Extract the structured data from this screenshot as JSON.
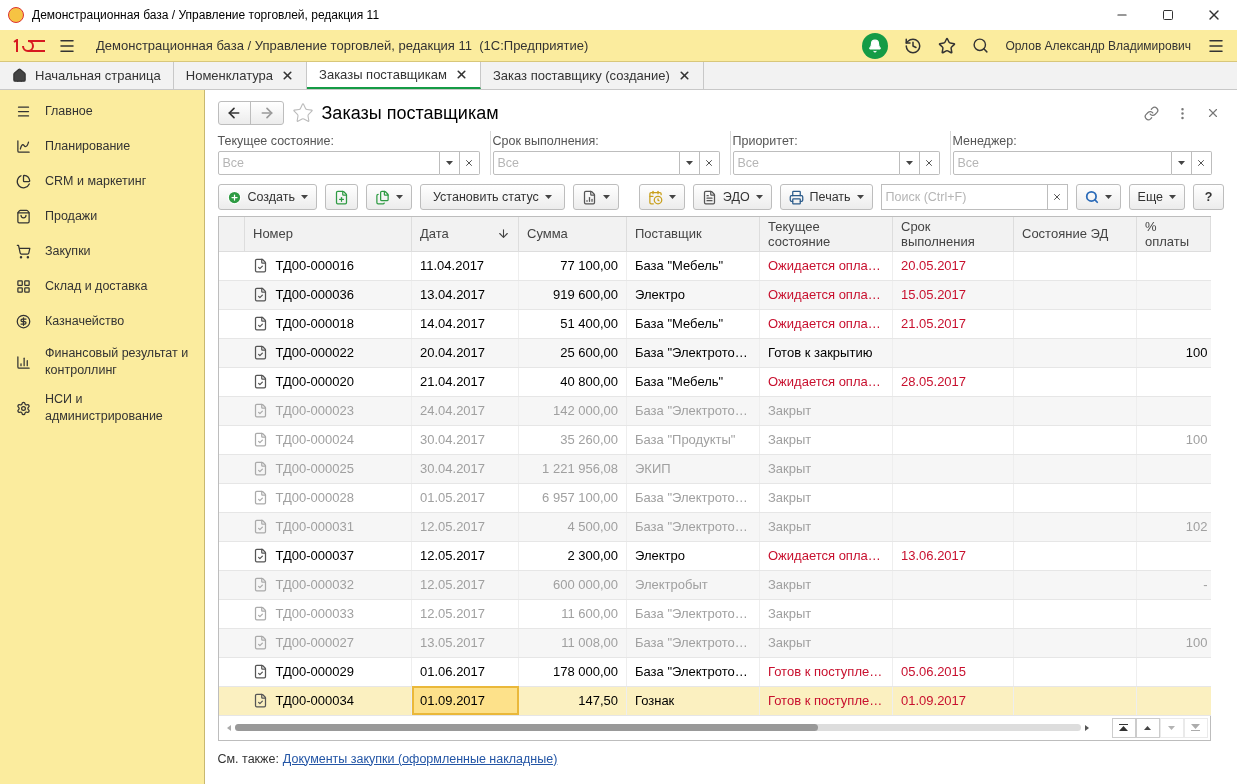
{
  "window": {
    "title": "Демонстрационная база / Управление торговлей, редакция 11"
  },
  "header": {
    "title": "Демонстрационная база / Управление торговлей, редакция 11  (1С:Предприятие)",
    "user": "Орлов Александр Владимирович"
  },
  "tabs": [
    {
      "label": "Начальная страница",
      "selected": false,
      "closable": false
    },
    {
      "label": "Номенклатура",
      "selected": false,
      "closable": true
    },
    {
      "label": "Заказы поставщикам",
      "selected": true,
      "closable": true
    },
    {
      "label": "Заказ поставщику (создание)",
      "selected": false,
      "closable": true
    }
  ],
  "sidebar": {
    "items": [
      {
        "label": "Главное"
      },
      {
        "label": "Планирование"
      },
      {
        "label": "CRM и маркетинг"
      },
      {
        "label": "Продажи"
      },
      {
        "label": "Закупки"
      },
      {
        "label": "Склад и доставка"
      },
      {
        "label": "Казначейство"
      },
      {
        "label": "Финансовый результат и контроллинг"
      },
      {
        "label": "НСИ и администрирование"
      }
    ]
  },
  "form": {
    "title": "Заказы поставщикам",
    "filters": [
      {
        "label": "Текущее состояние:",
        "placeholder": "Все"
      },
      {
        "label": "Срок выполнения:",
        "placeholder": "Все"
      },
      {
        "label": "Приоритет:",
        "placeholder": "Все"
      },
      {
        "label": "Менеджер:",
        "placeholder": "Все"
      }
    ],
    "toolbar": {
      "create": "Создать",
      "set_status": "Установить статус",
      "edo": "ЭДО",
      "print": "Печать",
      "search_placeholder": "Поиск (Ctrl+F)",
      "more": "Еще",
      "help": "?"
    }
  },
  "table": {
    "columns": [
      {
        "label": "Номер",
        "sorted": false
      },
      {
        "label": "Дата",
        "sorted": true
      },
      {
        "label": "Сумма",
        "sorted": false
      },
      {
        "label": "Поставщик",
        "sorted": false
      },
      {
        "label": "Текущее состояние",
        "sorted": false
      },
      {
        "label": "Срок выполнения",
        "sorted": false
      },
      {
        "label": "Состояние ЭД",
        "sorted": false
      },
      {
        "label": "% оплаты",
        "sorted": false
      }
    ],
    "rows": [
      {
        "number": "ТД00-000016",
        "date": "11.04.2017",
        "sum": "77 100,00",
        "supplier": "База \"Мебель\"",
        "status": "Ожидается опла…",
        "due": "20.05.2017",
        "paid": "",
        "closed": false,
        "alert": true,
        "selected": false
      },
      {
        "number": "ТД00-000036",
        "date": "13.04.2017",
        "sum": "919 600,00",
        "supplier": "Электро",
        "status": "Ожидается опла…",
        "due": "15.05.2017",
        "paid": "",
        "closed": false,
        "alert": true,
        "selected": false
      },
      {
        "number": "ТД00-000018",
        "date": "14.04.2017",
        "sum": "51 400,00",
        "supplier": "База \"Мебель\"",
        "status": "Ожидается опла…",
        "due": "21.05.2017",
        "paid": "",
        "closed": false,
        "alert": true,
        "selected": false
      },
      {
        "number": "ТД00-000022",
        "date": "20.04.2017",
        "sum": "25 600,00",
        "supplier": "База \"Электрото…",
        "status": "Готов к закрытию",
        "due": "",
        "paid": "100",
        "closed": false,
        "alert": false,
        "selected": false
      },
      {
        "number": "ТД00-000020",
        "date": "21.04.2017",
        "sum": "40 800,00",
        "supplier": "База \"Мебель\"",
        "status": "Ожидается опла…",
        "due": "28.05.2017",
        "paid": "",
        "closed": false,
        "alert": true,
        "selected": false
      },
      {
        "number": "ТД00-000023",
        "date": "24.04.2017",
        "sum": "142 000,00",
        "supplier": "База \"Электрото…",
        "status": "Закрыт",
        "due": "",
        "paid": "",
        "closed": true,
        "alert": false,
        "selected": false
      },
      {
        "number": "ТД00-000024",
        "date": "30.04.2017",
        "sum": "35 260,00",
        "supplier": "База \"Продукты\"",
        "status": "Закрыт",
        "due": "",
        "paid": "100",
        "closed": true,
        "alert": false,
        "selected": false
      },
      {
        "number": "ТД00-000025",
        "date": "30.04.2017",
        "sum": "1 221 956,08",
        "supplier": "ЭКИП",
        "status": "Закрыт",
        "due": "",
        "paid": "",
        "closed": true,
        "alert": false,
        "selected": false
      },
      {
        "number": "ТД00-000028",
        "date": "01.05.2017",
        "sum": "6 957 100,00",
        "supplier": "База \"Электрото…",
        "status": "Закрыт",
        "due": "",
        "paid": "",
        "closed": true,
        "alert": false,
        "selected": false
      },
      {
        "number": "ТД00-000031",
        "date": "12.05.2017",
        "sum": "4 500,00",
        "supplier": "База \"Электрото…",
        "status": "Закрыт",
        "due": "",
        "paid": "102",
        "closed": true,
        "alert": false,
        "selected": false
      },
      {
        "number": "ТД00-000037",
        "date": "12.05.2017",
        "sum": "2 300,00",
        "supplier": "Электро",
        "status": "Ожидается опла…",
        "due": "13.06.2017",
        "paid": "",
        "closed": false,
        "alert": true,
        "selected": false
      },
      {
        "number": "ТД00-000032",
        "date": "12.05.2017",
        "sum": "600 000,00",
        "supplier": "Электробыт",
        "status": "Закрыт",
        "due": "",
        "paid": "-",
        "closed": true,
        "alert": false,
        "selected": false
      },
      {
        "number": "ТД00-000033",
        "date": "12.05.2017",
        "sum": "11 600,00",
        "supplier": "База \"Электрото…",
        "status": "Закрыт",
        "due": "",
        "paid": "",
        "closed": true,
        "alert": false,
        "selected": false
      },
      {
        "number": "ТД00-000027",
        "date": "13.05.2017",
        "sum": "11 008,00",
        "supplier": "База \"Электрото…",
        "status": "Закрыт",
        "due": "",
        "paid": "100",
        "closed": true,
        "alert": false,
        "selected": false
      },
      {
        "number": "ТД00-000029",
        "date": "01.06.2017",
        "sum": "178 000,00",
        "supplier": "База \"Электрото…",
        "status": "Готов к поступле…",
        "due": "05.06.2015",
        "paid": "",
        "closed": false,
        "alert": true,
        "selected": false
      },
      {
        "number": "ТД00-000034",
        "date": "01.09.2017",
        "sum": "147,50",
        "supplier": "Гознак",
        "status": "Готов к поступле…",
        "due": "01.09.2017",
        "paid": "",
        "closed": false,
        "alert": true,
        "selected": true
      }
    ]
  },
  "footer": {
    "label": "См. также:",
    "link": "Документы закупки (оформленные накладные)"
  }
}
